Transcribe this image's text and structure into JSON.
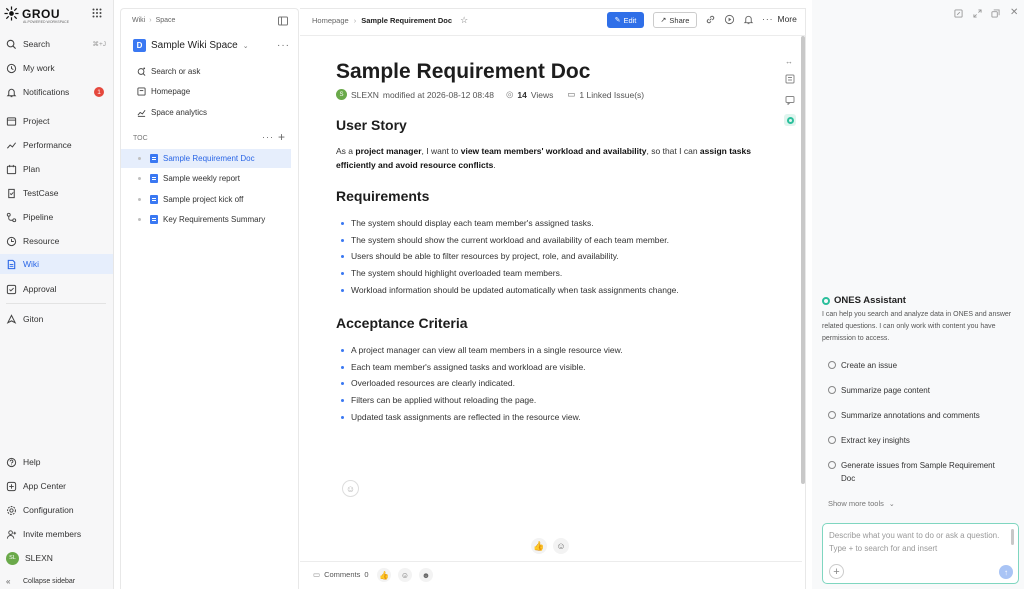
{
  "app": {
    "logo_text": "GROU",
    "logo_subtext": "AI-POWERED WORKSPACE"
  },
  "nav": {
    "search": {
      "label": "Search",
      "shortcut": "⌘+J"
    },
    "top_items": [
      {
        "label": "My work",
        "icon": "my-work-icon"
      },
      {
        "label": "Notifications",
        "icon": "bell-icon",
        "badge": "1"
      }
    ],
    "items": [
      {
        "label": "Project",
        "icon": "project-icon"
      },
      {
        "label": "Performance",
        "icon": "performance-icon"
      },
      {
        "label": "Plan",
        "icon": "plan-icon"
      },
      {
        "label": "TestCase",
        "icon": "testcase-icon"
      },
      {
        "label": "Pipeline",
        "icon": "pipeline-icon"
      },
      {
        "label": "Resource",
        "icon": "resource-icon"
      },
      {
        "label": "Wiki",
        "icon": "wiki-icon",
        "active": true
      },
      {
        "label": "Approval",
        "icon": "approval-icon"
      },
      {
        "label": "Giton",
        "icon": "giton-icon"
      }
    ],
    "bottom_items": [
      {
        "label": "Help",
        "icon": "help-icon"
      },
      {
        "label": "App Center",
        "icon": "app-center-icon"
      },
      {
        "label": "Configuration",
        "icon": "gear-icon"
      },
      {
        "label": "Invite members",
        "icon": "invite-icon"
      }
    ],
    "user": {
      "initials": "SL",
      "name": "SLEXN"
    },
    "collapse_label": "Collapse sidebar"
  },
  "wiki_sidebar": {
    "breadcrumb": [
      "Wiki",
      "Space"
    ],
    "space_name": "Sample Wiki Space",
    "links": [
      {
        "label": "Search or ask"
      },
      {
        "label": "Homepage"
      },
      {
        "label": "Space analytics"
      }
    ],
    "toc_label": "TOC",
    "toc_items": [
      {
        "label": "Sample Requirement Doc",
        "active": true
      },
      {
        "label": "Sample weekly report"
      },
      {
        "label": "Sample project kick off"
      },
      {
        "label": "Key Requirements Summary"
      }
    ]
  },
  "doc_toolbar": {
    "breadcrumb_home": "Homepage",
    "breadcrumb_current": "Sample Requirement Doc",
    "edit_label": "Edit",
    "share_label": "Share",
    "more_label": "More"
  },
  "doc": {
    "title": "Sample Requirement Doc",
    "author_initial": "S",
    "author": "SLEXN",
    "modified_text": "modified at 2026-08-12 08:48",
    "views_count": "14",
    "views_label": "Views",
    "linked_issues": "1 Linked Issue(s)",
    "user_story_heading": "User Story",
    "user_story": {
      "p1": "As a ",
      "b1": "project manager",
      "p2": ", I want to ",
      "b2": "view team members' workload and availability",
      "p3": ", so that I can ",
      "b3": "assign tasks efficiently and avoid resource conflicts",
      "p4": "."
    },
    "requirements_heading": "Requirements",
    "requirements": [
      "The system should display each team member's assigned tasks.",
      "The system should show the current workload and availability of each team member.",
      "Users should be able to filter resources by project, role, and availability.",
      "The system should highlight overloaded team members.",
      "Workload information should be updated automatically when task assignments change."
    ],
    "acceptance_heading": "Acceptance Criteria",
    "acceptance": [
      "A project manager can view all team members in a single resource view.",
      "Each team member's assigned tasks and workload are visible.",
      "Overloaded resources are clearly indicated.",
      "Filters can be applied without reloading the page.",
      "Updated task assignments are reflected in the resource view."
    ]
  },
  "comments": {
    "label": "Comments",
    "count": "0"
  },
  "assistant": {
    "title": "ONES Assistant",
    "description": "I can help you search and analyze data in ONES and answer related questions. I can only work with content you have permission to access.",
    "tools": [
      "Create an issue",
      "Summarize page content",
      "Summarize annotations and comments",
      "Extract key insights",
      "Generate issues from Sample Requirement Doc"
    ],
    "show_more": "Show more tools",
    "input_placeholder": "Describe what you want to do or ask a question. Type + to search for and insert"
  },
  "colors": {
    "accent": "#2f6fe8",
    "active_bg": "#e6eefc",
    "assistant_accent": "#2bbf9c",
    "badge": "#e5483d"
  }
}
